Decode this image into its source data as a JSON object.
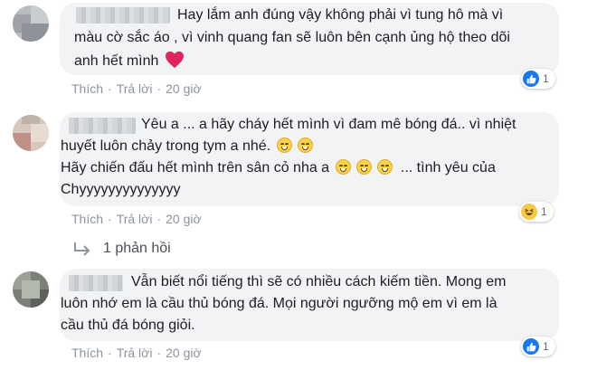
{
  "comments": [
    {
      "text_lines": [
        "Hay lắm anh đúng vậy không phải vì tung hô mà vì",
        "màu cờ sắc áo , vì vinh quang fan sẽ luôn bên cạnh ủng hộ theo dõi",
        "anh hết mình"
      ],
      "actions": {
        "like": "Thích",
        "reply": "Trả lời",
        "time": "20 giờ"
      },
      "reaction": {
        "icon": "like-icon",
        "count": "1"
      }
    },
    {
      "text_lines": [
        "Yêu a ... a hãy cháy hết mình vì đam mê bóng đá.. vì nhiệt",
        "huyết luôn chảy trong tym a nhé.",
        "Hãy chiến đấu hết mình trên sân cỏ nha a",
        "... tình yêu của",
        "Chyyyyyyyyyyyyyy"
      ],
      "actions": {
        "like": "Thích",
        "reply": "Trả lời",
        "time": "20 giờ"
      },
      "reaction": {
        "icon": "haha-icon",
        "count": "1"
      },
      "replies_link": "1 phản hồi"
    },
    {
      "text_lines": [
        "Vẫn biết nổi tiếng thì sẽ có nhiều cách kiếm tiền. Mong em",
        "luôn nhớ em là cầu thủ bóng đá. Mọi người ngưỡng mộ em vì em là",
        "cầu thủ đá bóng giỏi."
      ],
      "actions": {
        "like": "Thích",
        "reply": "Trả lời",
        "time": "20 giờ"
      },
      "reaction": {
        "icon": "like-icon",
        "count": "1"
      }
    }
  ],
  "separator": "·",
  "colors": {
    "bubble": "#f2f3f5",
    "like_blue": "#1877f2",
    "heart_red": "#e0245e",
    "meta_gray": "#90949c"
  }
}
